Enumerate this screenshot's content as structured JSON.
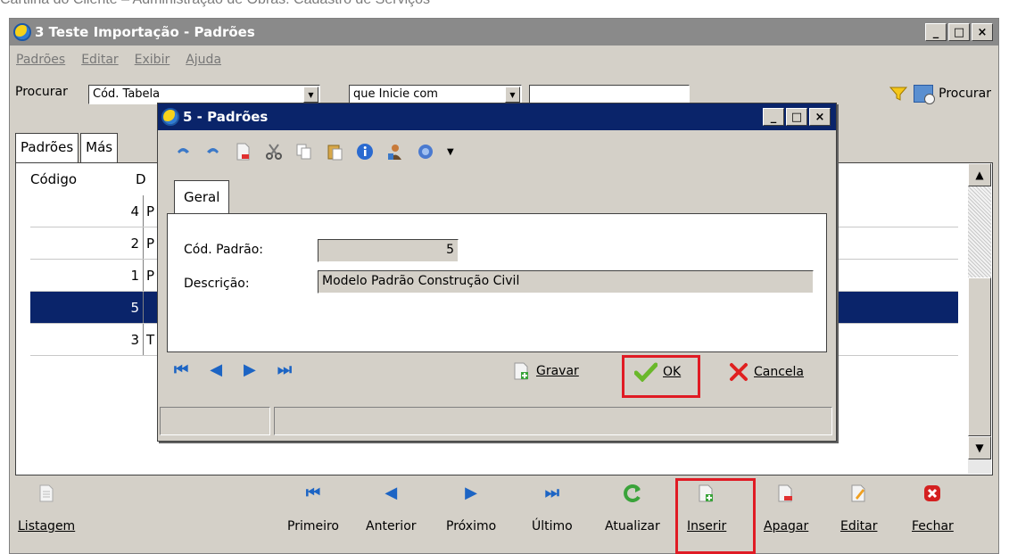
{
  "doc_caption": "Cartilha do Cliente – Administração de Obras: Cadastro de Serviços",
  "main_window": {
    "title": "3 Teste Importação - Padrões",
    "controls": {
      "minimize": "_",
      "maximize": "□",
      "close": "×"
    },
    "menu": [
      "Padrões",
      "Editar",
      "Exibir",
      "Ajuda"
    ],
    "search": {
      "label": "Procurar",
      "field_value": "Cód. Tabela",
      "operator_value": "que Inicie com",
      "query_value": "",
      "button_label": "Procurar"
    },
    "tabs": [
      "Padrões",
      "Más"
    ],
    "grid": {
      "columns": [
        "Código",
        "D"
      ],
      "rows": [
        {
          "code": "4",
          "desc": "P",
          "selected": false
        },
        {
          "code": "2",
          "desc": "P",
          "selected": false
        },
        {
          "code": "1",
          "desc": "P",
          "selected": false
        },
        {
          "code": "5",
          "desc": "",
          "selected": true
        },
        {
          "code": "3",
          "desc": "T",
          "selected": false
        }
      ]
    }
  },
  "bottom_toolbar": {
    "items": [
      {
        "label": "Listagem",
        "icon": "document-icon"
      },
      {
        "label": "Primeiro",
        "icon": "first-record-icon"
      },
      {
        "label": "Anterior",
        "icon": "previous-record-icon"
      },
      {
        "label": "Próximo",
        "icon": "next-record-icon"
      },
      {
        "label": "Último",
        "icon": "last-record-icon"
      },
      {
        "label": "Atualizar",
        "icon": "refresh-icon"
      },
      {
        "label": "Inserir",
        "icon": "insert-icon",
        "highlighted": true
      },
      {
        "label": "Apagar",
        "icon": "delete-icon"
      },
      {
        "label": "Editar",
        "icon": "edit-icon"
      },
      {
        "label": "Fechar",
        "icon": "close-icon"
      }
    ]
  },
  "dialog": {
    "title": "5 - Padrões",
    "controls": {
      "minimize": "_",
      "maximize": "□",
      "close": "×"
    },
    "toolbar_icons": [
      "undo-icon",
      "redo-icon",
      "new-document-icon",
      "cut-icon",
      "copy-icon",
      "paste-icon",
      "info-icon",
      "user-icon",
      "help-icon",
      "dropdown-arrow-icon"
    ],
    "tab": "Geral",
    "fields": {
      "code_label": "Cód. Padrão:",
      "code_value": "5",
      "description_label": "Descrição:",
      "description_value": "Modelo Padrão Construção Civil"
    },
    "actions": {
      "save": "Gravar",
      "ok": "OK",
      "cancel": "Cancela"
    }
  },
  "colors": {
    "active_title": "#0a246a",
    "inactive_title": "#8a8a8a",
    "highlight": "#e01b24",
    "nav_blue": "#1c64c4"
  }
}
